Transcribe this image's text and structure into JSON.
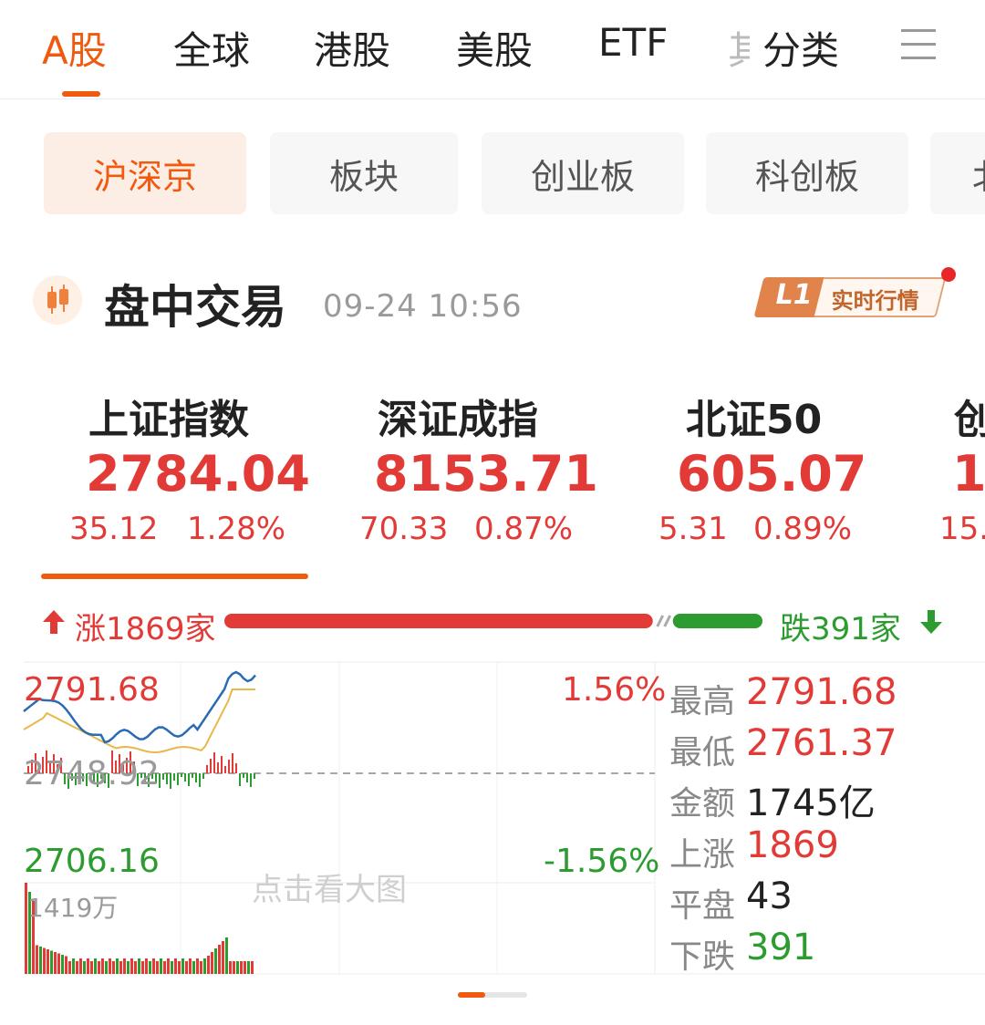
{
  "top_tabs": [
    "A股",
    "全球",
    "港股",
    "美股",
    "ETF"
  ],
  "top_tab_clipped": "其",
  "top_tab_fenlei": "分类",
  "sub_tabs": [
    "沪深京",
    "板块",
    "创业板",
    "科创板"
  ],
  "sub_tab_clipped": "北",
  "section": {
    "title": "盘中交易",
    "time": "09-24 10:56",
    "badge_level": "L1",
    "badge_text": "实时行情"
  },
  "indices": [
    {
      "name": "上证指数",
      "value": "2784.04",
      "change": "35.12",
      "pct": "1.28%"
    },
    {
      "name": "深证成指",
      "value": "8153.71",
      "change": "70.33",
      "pct": "0.87%"
    },
    {
      "name": "北证50",
      "value": "605.07",
      "change": "5.31",
      "pct": "0.89%"
    },
    {
      "name": "创",
      "value": "1",
      "change": "15."
    }
  ],
  "breadth": {
    "up_label": "涨1869家",
    "down_label": "跌391家",
    "up": 1869,
    "flat": 43,
    "down": 391
  },
  "chart": {
    "high_label": "2791.68",
    "mid_label": "2748.92",
    "low_label": "2706.16",
    "pct_high": "1.56%",
    "pct_low": "-1.56%",
    "volume_label": "1419万",
    "hint": "点击看大图",
    "stats": [
      {
        "label": "最高",
        "value": "2791.68",
        "color": "#e23a36"
      },
      {
        "label": "最低",
        "value": "2761.37",
        "color": "#e23a36"
      },
      {
        "label": "金额",
        "value": "1745亿",
        "color": "#222222"
      },
      {
        "label": "上涨",
        "value": "1869",
        "color": "#e23a36"
      },
      {
        "label": "平盘",
        "value": "43",
        "color": "#222222"
      },
      {
        "label": "下跌",
        "value": "391",
        "color": "#2c9c31"
      }
    ]
  },
  "colors": {
    "accent": "#f05a0f",
    "up": "#e23a36",
    "down": "#2c9c31",
    "price_line": "#2a6bb3",
    "avg_line": "#e8b84a"
  }
}
